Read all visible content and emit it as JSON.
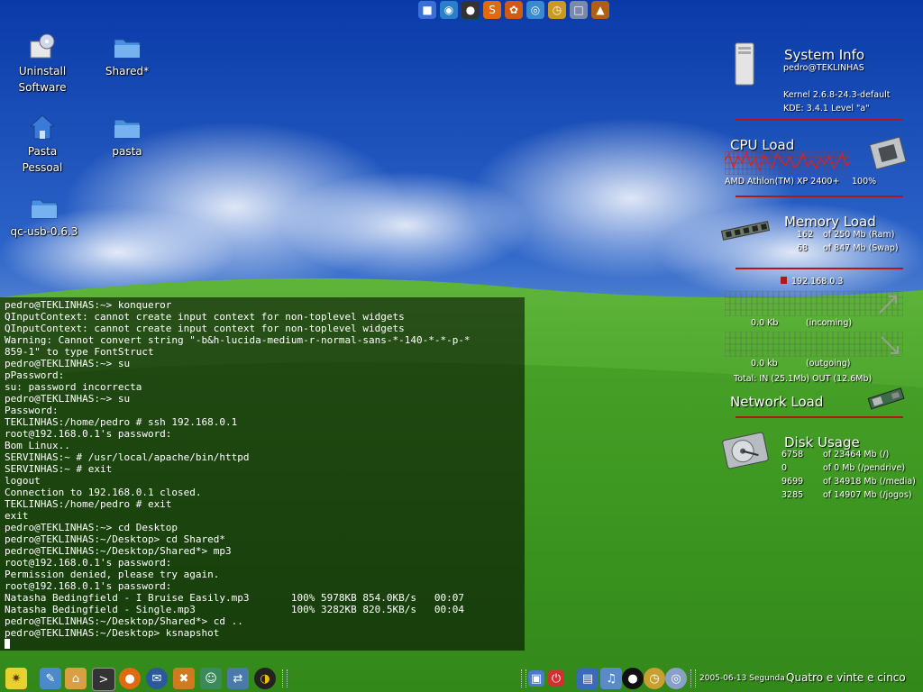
{
  "desktop": {
    "icons": [
      {
        "label": "Uninstall\nSoftware",
        "icon": "cd-box-icon"
      },
      {
        "label": "Shared*",
        "icon": "folder-icon"
      },
      {
        "label": "Pasta\nPessoal",
        "icon": "home-folder-icon"
      },
      {
        "label": "pasta",
        "icon": "folder-icon"
      },
      {
        "label": "qc-usb-0.6.3",
        "icon": "folder-icon"
      }
    ]
  },
  "terminal": {
    "lines": [
      "pedro@TEKLINHAS:~> konqueror",
      "QInputContext: cannot create input context for non-toplevel widgets",
      "QInputContext: cannot create input context for non-toplevel widgets",
      "Warning: Cannot convert string \"-b&h-lucida-medium-r-normal-sans-*-140-*-*-p-*",
      "859-1\" to type FontStruct",
      "pedro@TEKLINHAS:~> su",
      "pPassword:",
      "su: password incorrecta",
      "pedro@TEKLINHAS:~> su",
      "Password:",
      "TEKLINHAS:/home/pedro # ssh 192.168.0.1",
      "root@192.168.0.1's password:",
      "Bom Linux..",
      "SERVINHAS:~ # /usr/local/apache/bin/httpd",
      "SERVINHAS:~ # exit",
      "logout",
      "Connection to 192.168.0.1 closed.",
      "TEKLINHAS:/home/pedro # exit",
      "exit",
      "pedro@TEKLINHAS:~> cd Desktop",
      "pedro@TEKLINHAS:~/Desktop> cd Shared*",
      "pedro@TEKLINHAS:~/Desktop/Shared*> mp3",
      "root@192.168.0.1's password:",
      "Permission denied, please try again.",
      "root@192.168.0.1's password:",
      "Natasha Bedingfield - I Bruise Easily.mp3       100% 5978KB 854.0KB/s   00:07",
      "Natasha Bedingfield - Single.mp3                100% 3282KB 820.5KB/s   00:04",
      "pedro@TEKLINHAS:~/Desktop/Shared*> cd ..",
      "pedro@TEKLINHAS:~/Desktop> ksnapshot"
    ]
  },
  "sysinfo": {
    "title": "System Info",
    "user": "pedro@TEKLINHAS",
    "kernel": "Kernel 2.6.8-24.3-default",
    "kde": "KDE: 3.4.1 Level \"a\""
  },
  "cpu": {
    "title": "CPU Load",
    "model": "AMD Athlon(TM) XP 2400+",
    "percent": "100%",
    "history": [
      0.6,
      0.9,
      0.3,
      0.8,
      0.5,
      0.95,
      0.4,
      0.7,
      0.2,
      0.85,
      0.5,
      0.3,
      0.9,
      0.6,
      0.4,
      0.75,
      0.3,
      0.5,
      0.9,
      0.35,
      0.6,
      0.25,
      0.7,
      0.45,
      0.8,
      0.3,
      0.55,
      0.9,
      0.4,
      0.6
    ]
  },
  "memory": {
    "title": "Memory Load",
    "ram_used": "162",
    "ram_total": "of 250 Mb (Ram)",
    "swap_used": "68",
    "swap_total": "of 847 Mb (Swap)"
  },
  "network": {
    "title": "Network Load",
    "ip": "192.168.0.3",
    "in_rate": "0.0 Kb",
    "in_label": "(incoming)",
    "out_rate": "0.0 kb",
    "out_label": "(outgoing)",
    "totals": "Total:  IN   (25.1Mb)    OUT  (12.6Mb)"
  },
  "disk": {
    "title": "Disk Usage",
    "rows": [
      {
        "used": "6758",
        "total": "of 23464 Mb (/)"
      },
      {
        "used": "0",
        "total": "of 0 Mb (/pendrive)"
      },
      {
        "used": "9699",
        "total": "of 34918 Mb (/media)"
      },
      {
        "used": "3285",
        "total": "of 14907 Mb (/jogos)"
      }
    ]
  },
  "clock": {
    "date": "2005-06-13  Segunda",
    "time": "Quatro e vinte e cinco"
  },
  "colors": {
    "accent_red": "#b01818",
    "terminal_bg": "rgba(0,0,0,0.55)"
  }
}
